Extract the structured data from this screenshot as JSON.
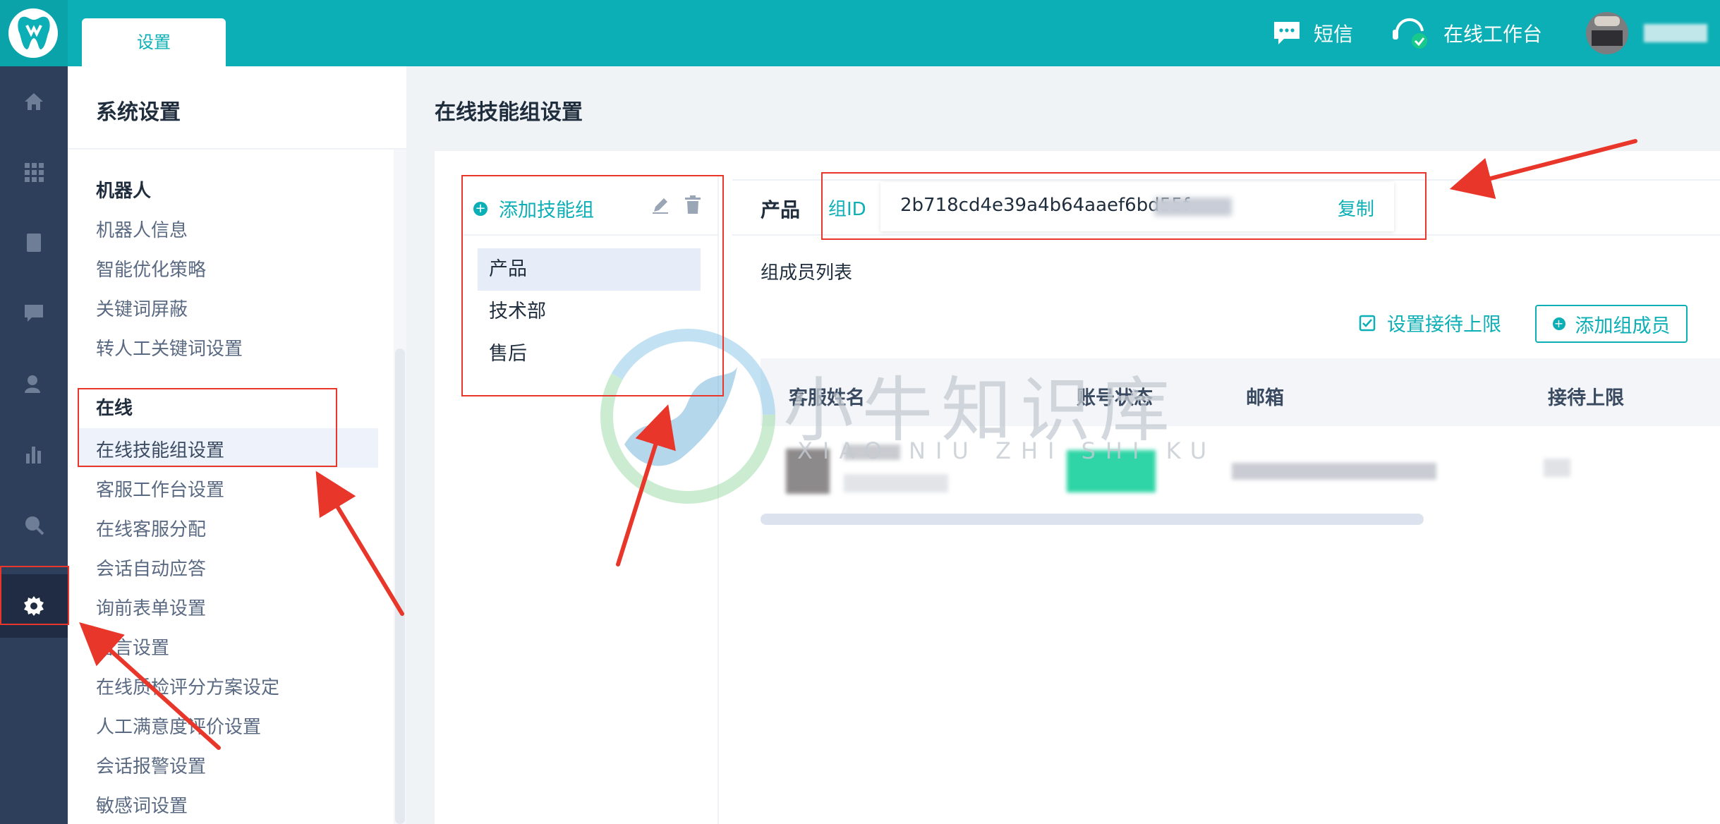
{
  "topbar": {
    "tab_label": "设置",
    "sms_label": "短信",
    "workbench_label": "在线工作台",
    "accent": "#0cafb5"
  },
  "menu": {
    "title": "系统设置",
    "groups": [
      {
        "label": "机器人",
        "items": [
          "机器人信息",
          "智能优化策略",
          "关键词屏蔽",
          "转人工关键词设置"
        ]
      },
      {
        "label": "在线",
        "items": [
          "在线技能组设置",
          "客服工作台设置",
          "在线客服分配",
          "会话自动应答",
          "询前表单设置",
          "留言设置",
          "在线质检评分方案设定",
          "人工满意度评价设置",
          "会话报警设置",
          "敏感词设置"
        ]
      }
    ],
    "selected": "在线技能组设置"
  },
  "page": {
    "title": "在线技能组设置",
    "add_group_label": "添加技能组",
    "groups": [
      "产品",
      "技术部",
      "售后"
    ],
    "selected_group": "产品",
    "group_id_label": "组ID",
    "group_id_value": "2b718cd4e39a4b64aaef6bd55f",
    "copy_label": "复制",
    "members_title": "组成员列表",
    "set_limit_label": "设置接待上限",
    "add_member_label": "添加组成员",
    "table_headers": [
      "客服姓名",
      "账号状态",
      "邮箱",
      "接待上限"
    ]
  },
  "watermark": {
    "text": "小牛知识库",
    "sub": "XIAO NIU ZHI SHI KU"
  }
}
